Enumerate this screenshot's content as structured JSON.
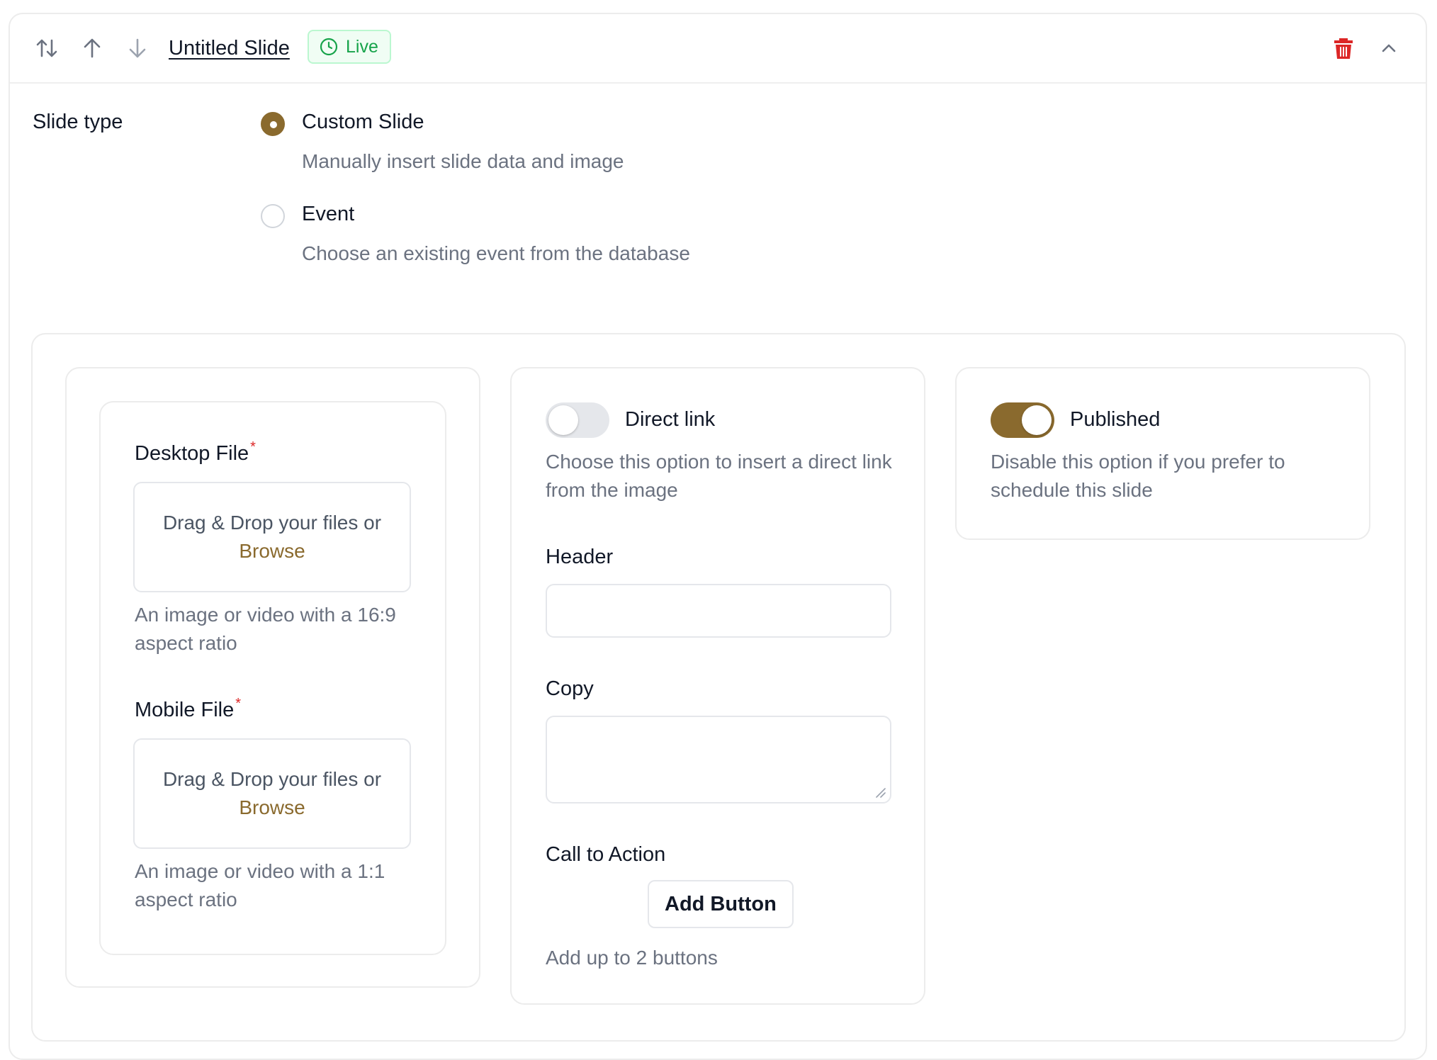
{
  "slide": {
    "title": "Untitled Slide",
    "status_badge": "Live"
  },
  "icons": {
    "reorder": "swap-vertical-icon",
    "move_up": "arrow-up-icon",
    "move_down": "arrow-down-icon",
    "status": "clock-icon",
    "delete": "trash-icon",
    "collapse": "chevron-up-icon"
  },
  "colors": {
    "accent": "#8a6a2e",
    "delete": "#dc2626",
    "live_bg": "#f0fdf4",
    "live_text": "#16a34a"
  },
  "slide_type": {
    "label": "Slide type",
    "selected": "custom",
    "options": [
      {
        "id": "custom",
        "title": "Custom Slide",
        "description": "Manually insert slide data and image"
      },
      {
        "id": "event",
        "title": "Event",
        "description": "Choose an existing event from the database"
      }
    ]
  },
  "media": {
    "desktop": {
      "label": "Desktop File",
      "required_mark": "*",
      "drop_text": "Drag & Drop your files or",
      "browse_text": "Browse",
      "hint": "An image or video with a 16:9 aspect ratio"
    },
    "mobile": {
      "label": "Mobile File",
      "required_mark": "*",
      "drop_text": "Drag & Drop your files or",
      "browse_text": "Browse",
      "hint": "An image or video with a 1:1 aspect ratio"
    }
  },
  "content": {
    "direct_link": {
      "label": "Direct link",
      "enabled": false,
      "description": "Choose this option to insert a direct link from the image"
    },
    "header": {
      "label": "Header",
      "value": "",
      "placeholder": ""
    },
    "copy": {
      "label": "Copy",
      "value": "",
      "placeholder": ""
    },
    "cta": {
      "label": "Call to Action",
      "button_label": "Add Button",
      "hint": "Add up to 2 buttons"
    }
  },
  "publish": {
    "label": "Published",
    "enabled": true,
    "description": "Disable this option if you prefer to schedule this slide"
  }
}
